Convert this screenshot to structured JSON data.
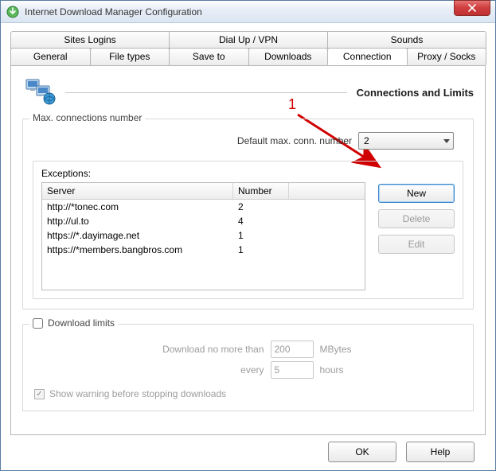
{
  "window": {
    "title": "Internet Download Manager Configuration",
    "icon": "idm-icon",
    "close_icon": "close-icon"
  },
  "tabs": {
    "row1": [
      {
        "label": "Sites Logins"
      },
      {
        "label": "Dial Up / VPN"
      },
      {
        "label": "Sounds"
      }
    ],
    "row2": [
      {
        "label": "General"
      },
      {
        "label": "File types"
      },
      {
        "label": "Save to"
      },
      {
        "label": "Downloads"
      },
      {
        "label": "Connection",
        "active": true
      },
      {
        "label": "Proxy / Socks"
      }
    ]
  },
  "section": {
    "title": "Connections and Limits",
    "icon": "network-icon"
  },
  "annotation": {
    "num": "1"
  },
  "max_conn": {
    "legend": "Max. connections number",
    "label": "Default max. conn. number",
    "value": "2"
  },
  "exceptions": {
    "label": "Exceptions:",
    "columns": {
      "server": "Server",
      "number": "Number"
    },
    "rows": [
      {
        "server": "http://*tonec.com",
        "number": "2"
      },
      {
        "server": "http://ul.to",
        "number": "4"
      },
      {
        "server": "https://*.dayimage.net",
        "number": "1"
      },
      {
        "server": "https://*members.bangbros.com",
        "number": "1"
      }
    ],
    "buttons": {
      "new": "New",
      "delete": "Delete",
      "edit": "Edit"
    }
  },
  "limits": {
    "checkbox_label": "Download limits",
    "line1_lead": "Download no more than",
    "line1_value": "200",
    "line1_unit": "MBytes",
    "line2_lead": "every",
    "line2_value": "5",
    "line2_unit": "hours",
    "warn_label": "Show warning before stopping downloads",
    "warn_checked": true
  },
  "footer": {
    "ok": "OK",
    "help": "Help"
  }
}
